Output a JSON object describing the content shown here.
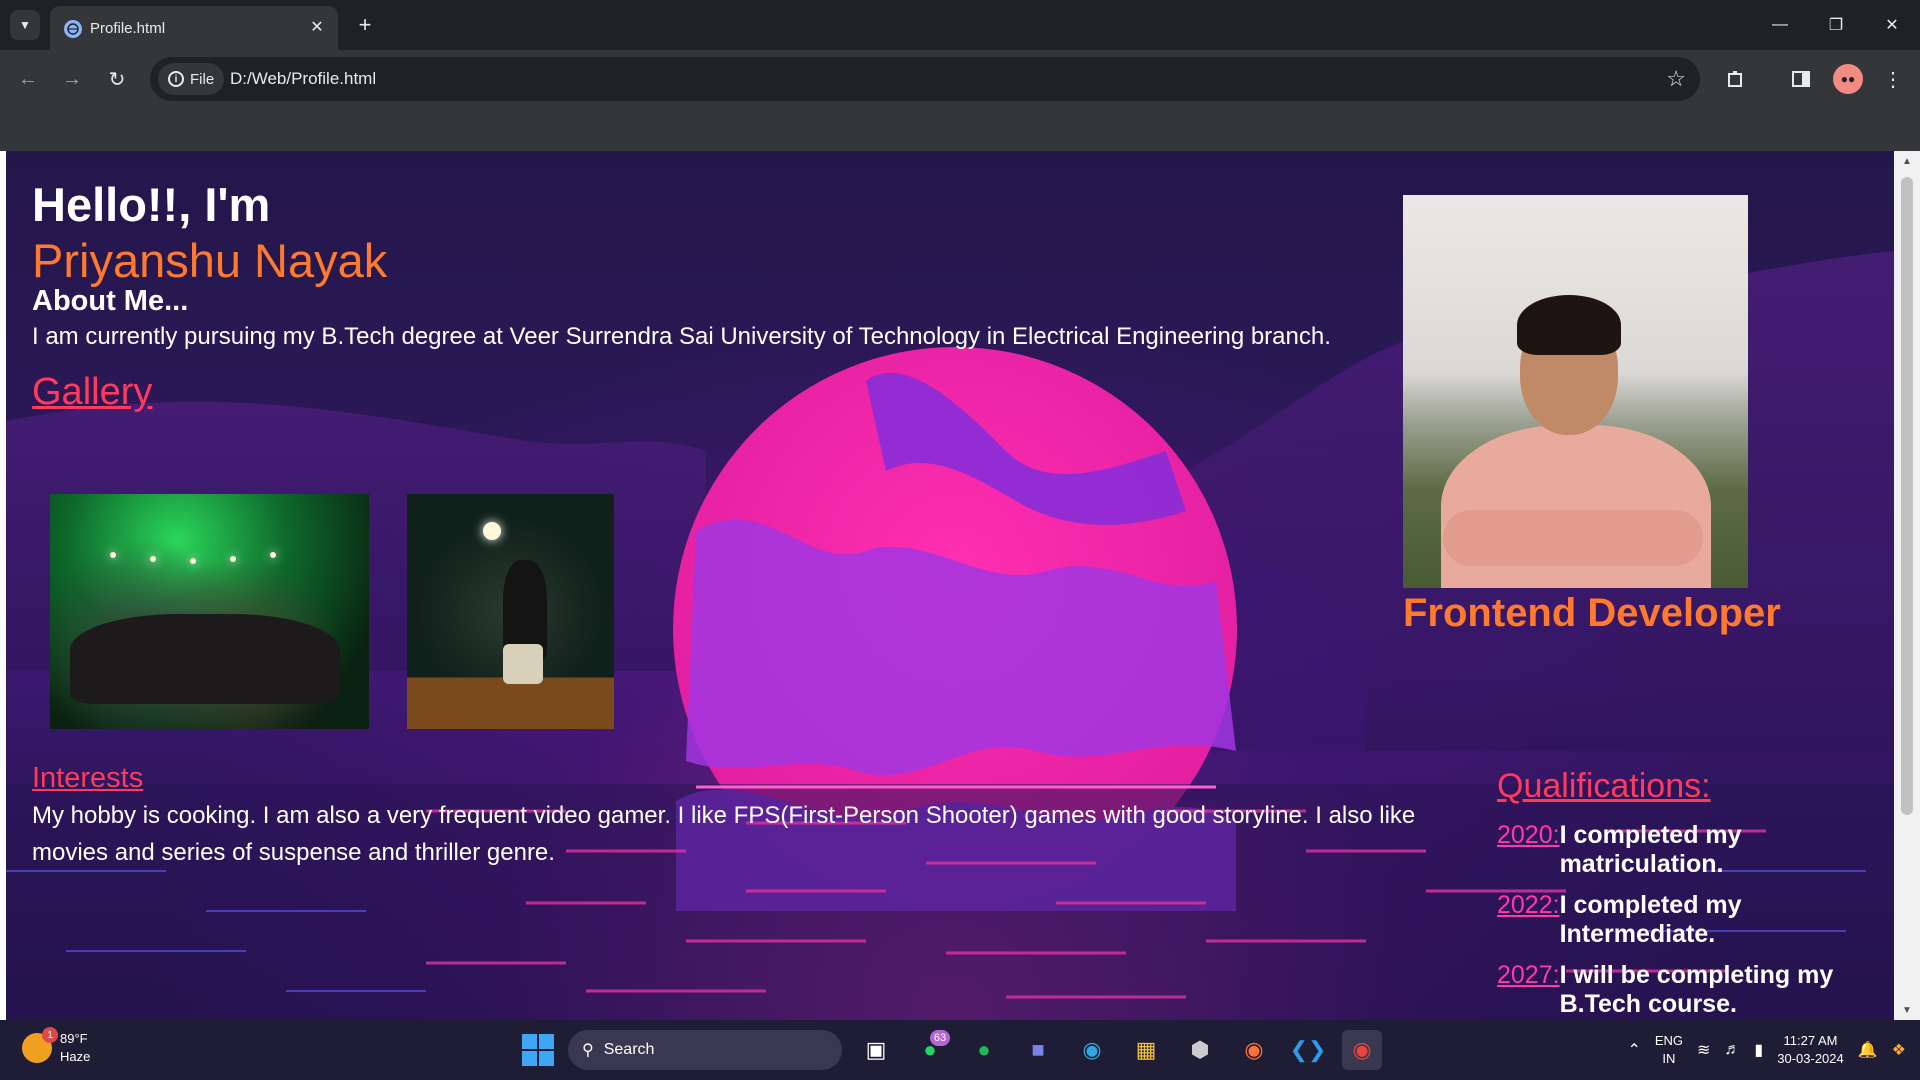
{
  "browser": {
    "tab_title": "Profile.html",
    "site_chip": "File",
    "url": "D:/Web/Profile.html",
    "icons": {
      "tab_search": "chevron-down-icon",
      "favicon": "globe-icon",
      "close": "close-icon",
      "new_tab": "plus-icon",
      "back": "arrow-left-icon",
      "forward": "arrow-right-icon",
      "reload": "reload-icon",
      "info": "info-icon",
      "star": "star-icon",
      "extensions": "puzzle-icon",
      "side_panel": "side-panel-icon",
      "menu": "kebab-menu-icon"
    }
  },
  "profile": {
    "greeting": "Hello!!, I'm",
    "name": "Priyanshu Nayak",
    "about_heading": "About Me...",
    "about_text": "I am currently pursuing my B.Tech degree at Veer Surrendra Sai University of Technology in Electrical Engineering branch.",
    "gallery_heading": "Gallery",
    "interests_heading": "Interests",
    "interests_text": "My hobby is cooking. I am also a very frequent video gamer. I like FPS(First-Person Shooter) games with good storyline. I also like movies and series of suspense and thriller genre.",
    "role": "Frontend Developer",
    "qualifications_heading": "Qualifications:",
    "qualifications": [
      {
        "year": "2020:",
        "text": "I completed my matriculation."
      },
      {
        "year": "2022:",
        "text": "I completed my Intermediate."
      },
      {
        "year": "2027:",
        "text": "I will be completing my B.Tech course."
      }
    ]
  },
  "colors": {
    "name_accent": "#ff7a2e",
    "link_red": "#ff3a5a",
    "year_pink": "#ff3aa8",
    "background": "#2b1858"
  },
  "taskbar": {
    "weather_temp": "89°F",
    "weather_cond": "Haze",
    "weather_badge": "1",
    "search_label": "Search",
    "whatsapp_badge": "63",
    "lang_top": "ENG",
    "lang_bottom": "IN",
    "time": "11:27 AM",
    "date": "30-03-2024"
  }
}
